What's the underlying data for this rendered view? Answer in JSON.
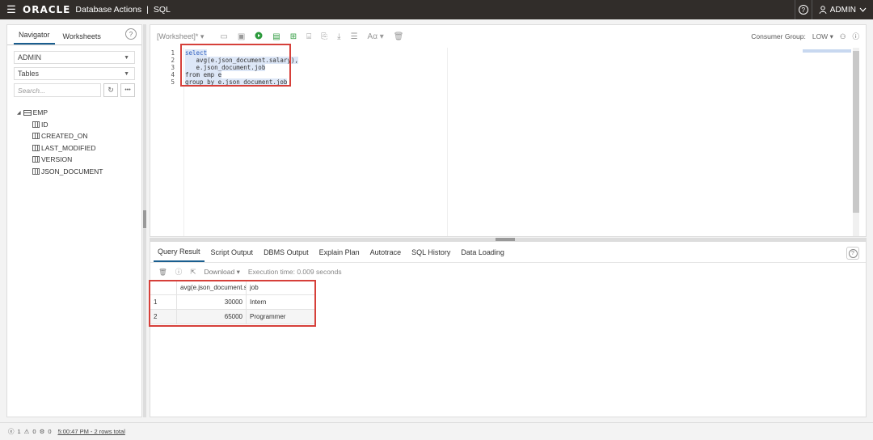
{
  "topbar": {
    "menu_glyph": "☰",
    "brand": "ORACLE",
    "app_title": "Database Actions",
    "separator": "|",
    "section": "SQL",
    "help_glyph": "?",
    "user": "ADMIN",
    "user_icon": "user-icon",
    "chevron": "⌵"
  },
  "navigator": {
    "tabs": [
      "Navigator",
      "Worksheets"
    ],
    "help_glyph": "?",
    "schema": "ADMIN",
    "object_type": "Tables",
    "search_placeholder": "Search...",
    "refresh_glyph": "↻",
    "more_glyph": "•••",
    "tree": {
      "table": "EMP",
      "columns": [
        "ID",
        "CREATED_ON",
        "LAST_MODIFIED",
        "VERSION",
        "JSON_DOCUMENT"
      ]
    }
  },
  "editor": {
    "worksheet_label": "[Worksheet]*",
    "consumer_group_label": "Consumer Group:",
    "consumer_group_value": "LOW",
    "font_label": "Aα",
    "lines": [
      {
        "no": "1",
        "text": "select"
      },
      {
        "no": "2",
        "text": "   avg(e.json_document.salary),"
      },
      {
        "no": "3",
        "text": "   e.json_document.job"
      },
      {
        "no": "4",
        "text": "from emp e"
      },
      {
        "no": "5",
        "text": "group by e.json_document.job"
      }
    ]
  },
  "results": {
    "tabs": [
      "Query Result",
      "Script Output",
      "DBMS Output",
      "Explain Plan",
      "Autotrace",
      "SQL History",
      "Data Loading"
    ],
    "help_glyph": "?",
    "download_label": "Download ▾",
    "execution_time": "Execution time: 0.009 seconds",
    "columns": [
      "avg(e.json_document.s",
      "job"
    ],
    "rows": [
      {
        "n": "1",
        "avg": "30000",
        "job": "Intern"
      },
      {
        "n": "2",
        "avg": "65000",
        "job": "Programmer"
      }
    ]
  },
  "status": {
    "errors": "1",
    "warnings": "0",
    "tasks": "0",
    "summary": "5:00:47 PM - 2 rows total"
  },
  "colors": {
    "topbar": "#312d2a",
    "active_tab": "#1a5e8f",
    "highlight_box": "#d6403a",
    "run_green": "#2c9a3c"
  }
}
